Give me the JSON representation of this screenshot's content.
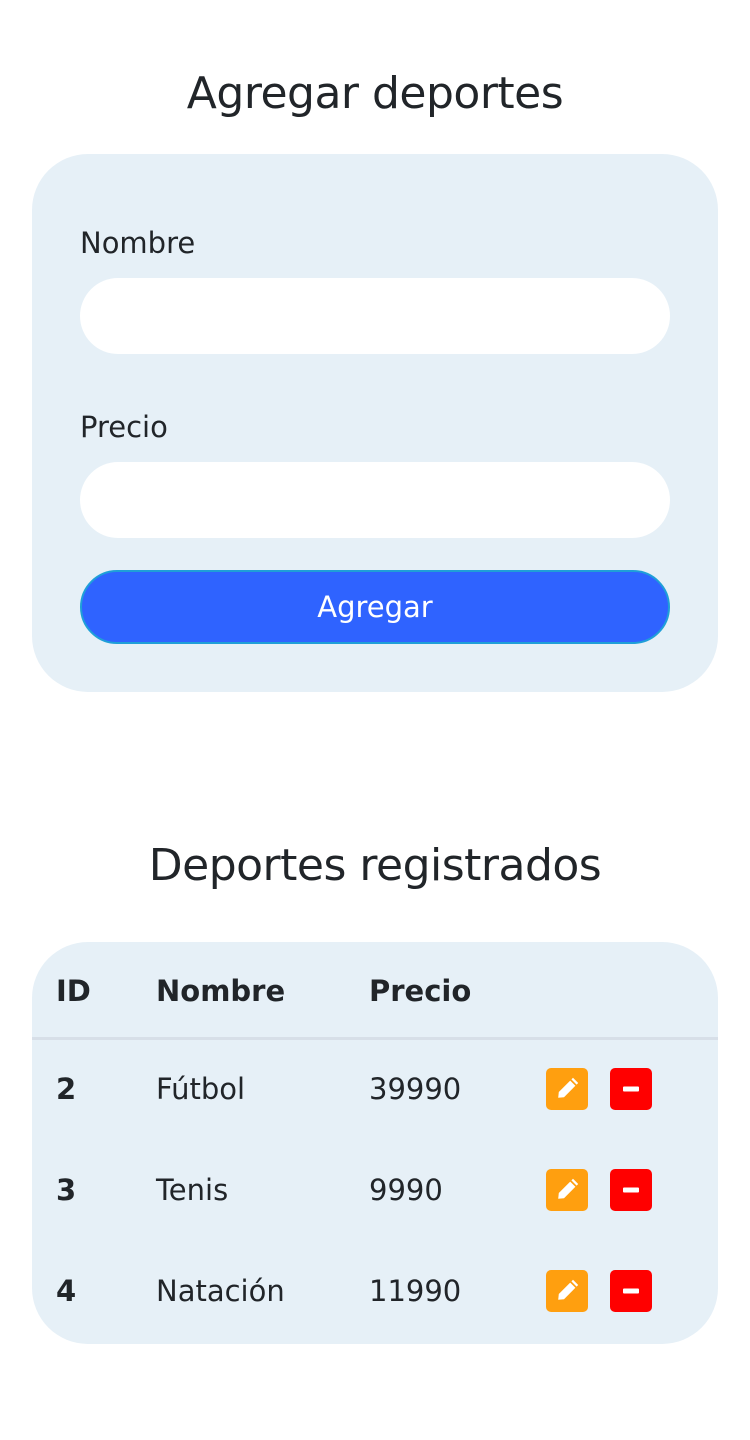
{
  "form": {
    "title": "Agregar deportes",
    "nombre_label": "Nombre",
    "nombre_value": "",
    "precio_label": "Precio",
    "precio_value": "",
    "submit_label": "Agregar"
  },
  "list": {
    "title": "Deportes registrados",
    "headers": {
      "id": "ID",
      "nombre": "Nombre",
      "precio": "Precio"
    },
    "rows": [
      {
        "id": "2",
        "nombre": "Fútbol",
        "precio": "39990"
      },
      {
        "id": "3",
        "nombre": "Tenis",
        "precio": "9990"
      },
      {
        "id": "4",
        "nombre": "Natación",
        "precio": "11990"
      }
    ],
    "edit_icon": "pencil-icon",
    "delete_icon": "minus-icon"
  },
  "colors": {
    "card_background": "#e6f0f7",
    "primary_button": "#2f63ff",
    "edit_button": "#ff9f0f",
    "delete_button": "#ff0000"
  }
}
